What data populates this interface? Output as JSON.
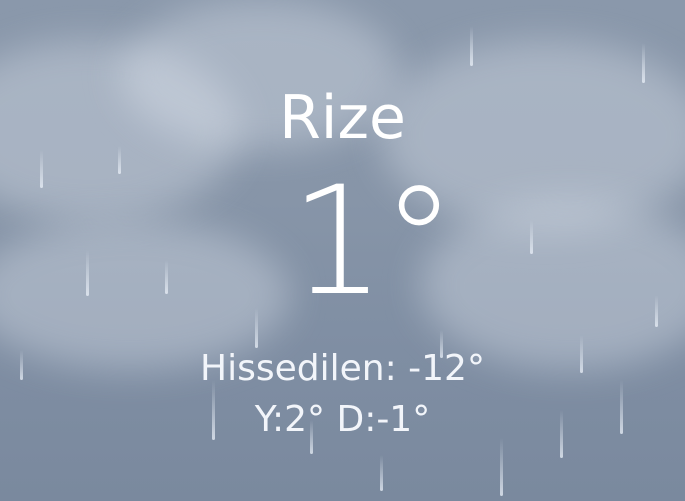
{
  "weather": {
    "city": "Rize",
    "temperature": "1°",
    "feels_like": "Hissedilen: -12°",
    "high_low": "Y:2° D:-1°",
    "condition_icon": "rain-clouds-background"
  }
}
